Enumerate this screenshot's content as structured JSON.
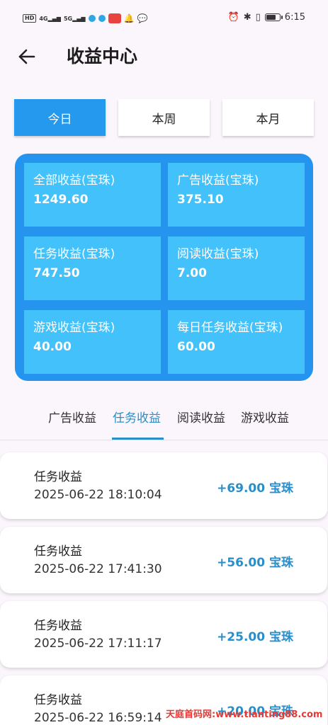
{
  "status_bar": {
    "chip": "HD",
    "signal_1": "4G",
    "signal_2": "5G",
    "time": "6:15",
    "battery_level": 0.75
  },
  "header": {
    "title": "收益中心"
  },
  "period_tabs": [
    {
      "label": "今日",
      "active": true
    },
    {
      "label": "本周",
      "active": false
    },
    {
      "label": "本月",
      "active": false
    }
  ],
  "stats": [
    {
      "label": "全部收益(宝珠)",
      "value": "1249.60"
    },
    {
      "label": "广告收益(宝珠)",
      "value": "375.10"
    },
    {
      "label": "任务收益(宝珠)",
      "value": "747.50"
    },
    {
      "label": "阅读收益(宝珠)",
      "value": "7.00"
    },
    {
      "label": "游戏收益(宝珠)",
      "value": "40.00"
    },
    {
      "label": "每日任务收益(宝珠)",
      "value": "60.00"
    }
  ],
  "category_tabs": [
    {
      "label": "广告收益",
      "active": false
    },
    {
      "label": "任务收益",
      "active": true
    },
    {
      "label": "阅读收益",
      "active": false
    },
    {
      "label": "游戏收益",
      "active": false
    }
  ],
  "records": [
    {
      "title": "任务收益",
      "time": "2025-06-22 18:10:04",
      "amount": "+69.00 宝珠"
    },
    {
      "title": "任务收益",
      "time": "2025-06-22 17:41:30",
      "amount": "+56.00 宝珠"
    },
    {
      "title": "任务收益",
      "time": "2025-06-22 17:11:17",
      "amount": "+25.00 宝珠"
    },
    {
      "title": "任务收益",
      "time": "2025-06-22 16:59:14",
      "amount": "+20.00 宝珠"
    }
  ],
  "watermark": "天庭首码网:www.tianting88.com",
  "colors": {
    "accent": "#2599ee",
    "panel": "#2594ef",
    "card": "#43c1fb",
    "amount": "#2b8ec8"
  }
}
